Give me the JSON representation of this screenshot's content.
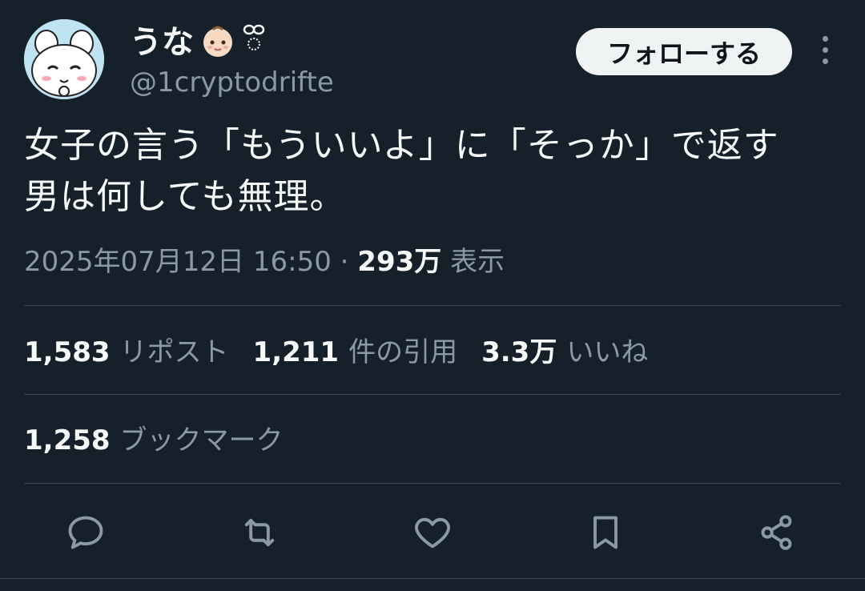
{
  "user": {
    "display_name": "うな",
    "handle": "@1cryptodrifte"
  },
  "follow_label": "フォローする",
  "tweet": {
    "line1": "女子の言う「もういいよ」に「そっか」で返す",
    "line2": "男は何しても無理。"
  },
  "meta": {
    "datetime": "2025年07月12日 16:50",
    "separator": "·",
    "views": "293万",
    "views_label": "表示"
  },
  "stats": {
    "reposts": "1,583",
    "reposts_label": "リポスト",
    "quotes": "1,211",
    "quotes_label": "件の引用",
    "likes": "3.3万",
    "likes_label": "いいね",
    "bookmarks": "1,258",
    "bookmarks_label": "ブックマーク"
  },
  "colors": {
    "background": "#15202b",
    "text": "#f7f9f9",
    "muted": "#8b98a5",
    "divider": "#38444d",
    "follow_bg": "#eff3f4"
  },
  "icons": [
    "reply-icon",
    "repost-icon",
    "like-icon",
    "bookmark-icon",
    "share-icon",
    "more-icon",
    "baby-emoji-icon",
    "sparkle-icon"
  ]
}
